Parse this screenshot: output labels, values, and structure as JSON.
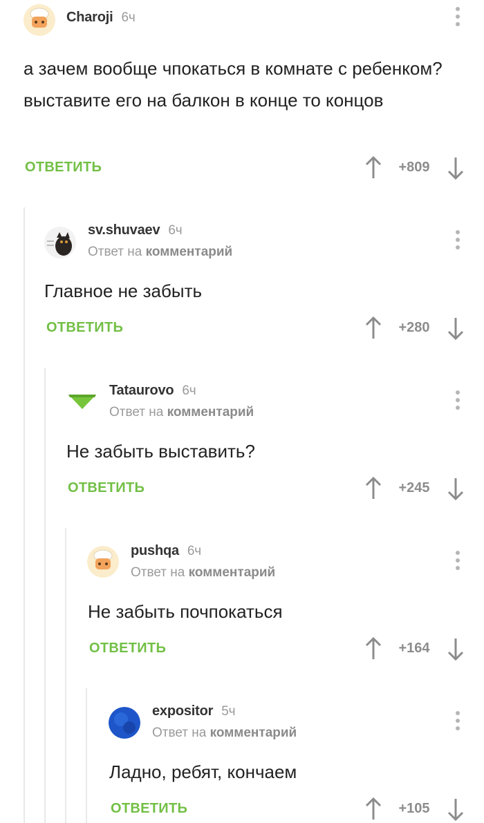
{
  "comments": [
    {
      "author": "Charoji",
      "time": "6ч",
      "reply_prefix": "",
      "reply_target": "",
      "text": "а зачем вообще чпокаться в комнате с ребенком? выставите его на балкон в конце то концов",
      "answer_label": "ОТВЕТИТЬ",
      "score": "+809",
      "avatar": "chef-avatar-icon"
    },
    {
      "author": "sv.shuvaev",
      "time": "6ч",
      "reply_prefix": "Ответ на",
      "reply_target": "комментарий",
      "text": "Главное не забыть",
      "answer_label": "ОТВЕТИТЬ",
      "score": "+280",
      "avatar": "cat-avatar-icon"
    },
    {
      "author": "Tataurovo",
      "time": "6ч",
      "reply_prefix": "Ответ на",
      "reply_target": "комментарий",
      "text": "Не забыть выставить?",
      "answer_label": "ОТВЕТИТЬ",
      "score": "+245",
      "avatar": "green-triangle-avatar-icon"
    },
    {
      "author": "pushqa",
      "time": "6ч",
      "reply_prefix": "Ответ на",
      "reply_target": "комментарий",
      "text": "Не забыть почпокаться",
      "answer_label": "ОТВЕТИТЬ",
      "score": "+164",
      "avatar": "chef-avatar-icon"
    },
    {
      "author": "expositor",
      "time": "5ч",
      "reply_prefix": "Ответ на",
      "reply_target": "комментарий",
      "text": "Ладно, ребят, кончаем",
      "answer_label": "ОТВЕТИТЬ",
      "score": "+105",
      "avatar": "blue-circle-avatar-icon"
    }
  ],
  "colors": {
    "answer": "#72bf45",
    "score": "#8c8c8c",
    "thread_line": "#e9e9e9",
    "meta": "#9a9a9a"
  }
}
